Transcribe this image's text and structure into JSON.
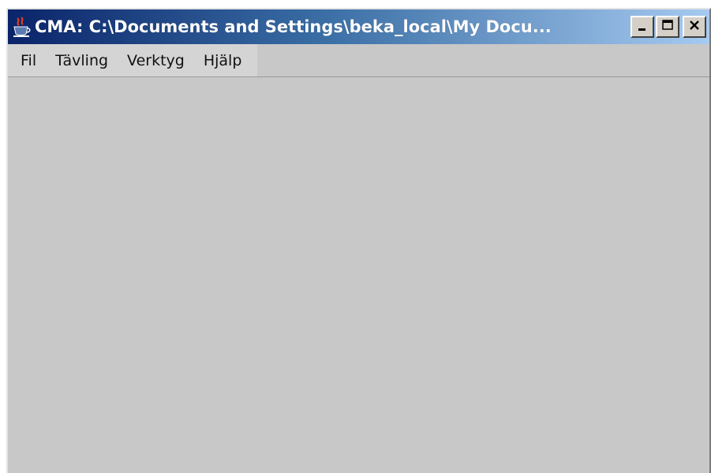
{
  "window": {
    "title": "CMA: C:\\Documents and Settings\\beka_local\\My Docu...",
    "app_icon": "java-cup-icon",
    "controls": {
      "minimize": "minimize-icon",
      "maximize": "maximize-icon",
      "close": "close-icon"
    }
  },
  "menubar": {
    "items": [
      "Fil",
      "Tävling",
      "Verktyg",
      "Hjälp"
    ]
  },
  "colors": {
    "titlebar_start": "#0a246a",
    "titlebar_end": "#a6caf0",
    "background": "#c8c8c8"
  }
}
